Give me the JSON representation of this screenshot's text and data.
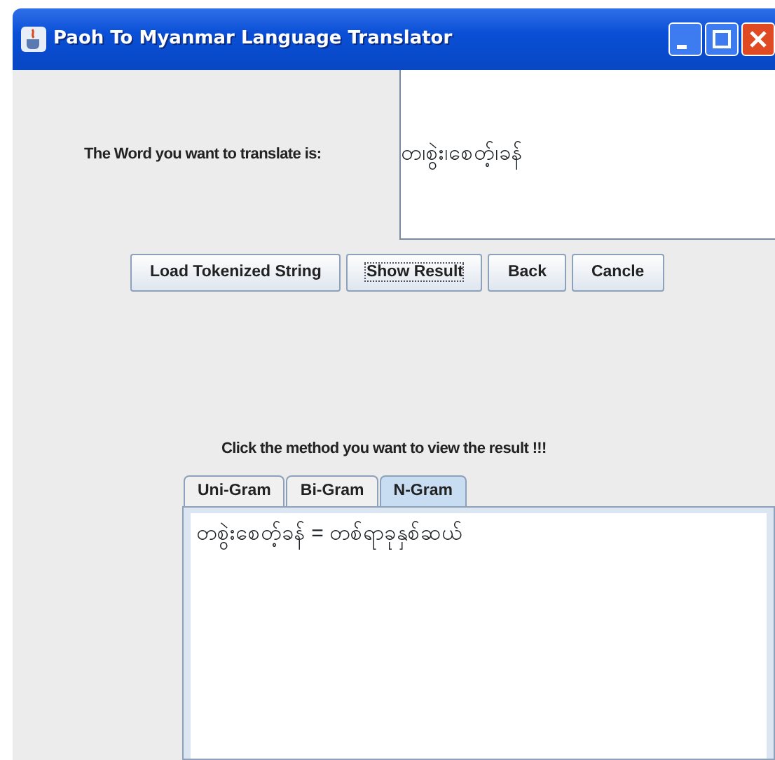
{
  "window": {
    "title": "Paoh To Myanmar Language Translator"
  },
  "input": {
    "label": "The Word you want to translate is:",
    "value": "တ၊စွဲး၊စေတ့်၊ခန်"
  },
  "buttons": [
    {
      "label": "Load Tokenized String",
      "focused": false
    },
    {
      "label": "Show Result",
      "focused": true
    },
    {
      "label": "Back",
      "focused": false
    },
    {
      "label": "Cancle",
      "focused": false
    }
  ],
  "method_prompt": "Click the method you want to view the result   !!!",
  "tabs": [
    {
      "label": "Uni-Gram",
      "selected": false
    },
    {
      "label": "Bi-Gram",
      "selected": false
    },
    {
      "label": "N-Gram",
      "selected": true
    }
  ],
  "result": "တစွဲးစေတ့်ခန်  =  တစ်ရာခုနှစ်ဆယ်"
}
